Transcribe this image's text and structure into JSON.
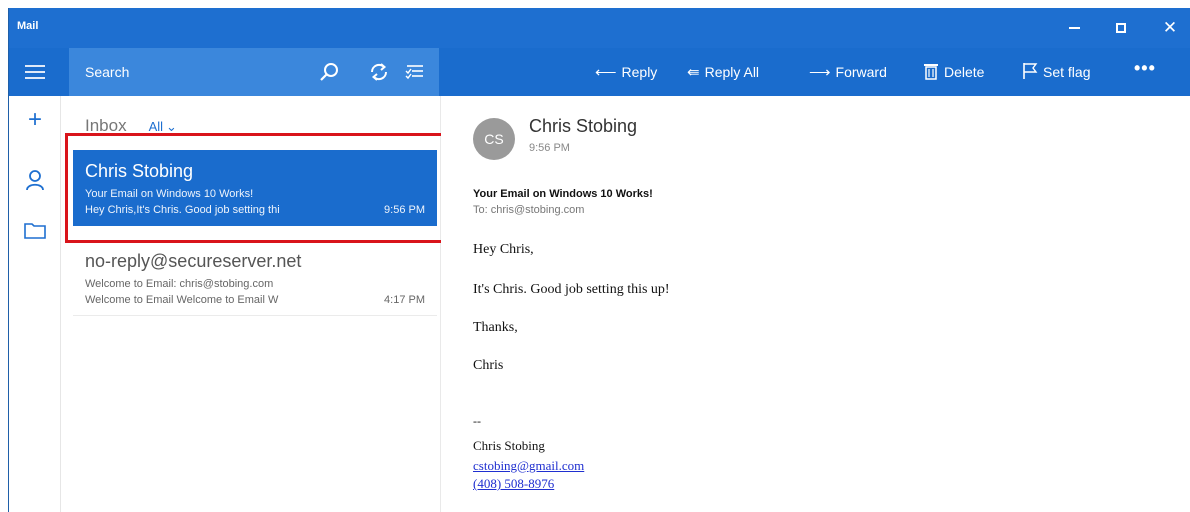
{
  "window": {
    "title": "Mail"
  },
  "search": {
    "placeholder": "Search"
  },
  "commands": {
    "reply": "Reply",
    "reply_all": "Reply All",
    "forward": "Forward",
    "delete": "Delete",
    "set_flag": "Set flag",
    "more": "•••"
  },
  "list": {
    "folder": "Inbox",
    "filter": "All",
    "messages": [
      {
        "sender": "Chris Stobing",
        "subject": "Your Email on Windows 10 Works!",
        "preview": "Hey Chris,It's Chris. Good job setting thi",
        "time": "9:56 PM",
        "selected": true
      },
      {
        "sender": "no-reply@secureserver.net",
        "subject": "Welcome to Email: chris@stobing.com",
        "preview": "Welcome to Email Welcome to Email W",
        "time": "4:17 PM",
        "selected": false
      }
    ]
  },
  "reading": {
    "avatar_initials": "CS",
    "from_name": "Chris Stobing",
    "time": "9:56 PM",
    "subject": "Your Email on Windows 10 Works!",
    "to": "To: chris@stobing.com",
    "greeting": "Hey Chris,",
    "body": "It's Chris. Good job setting this up!",
    "thanks": "Thanks,",
    "signoff": "Chris",
    "signature": {
      "dash": "--",
      "name": "Chris Stobing",
      "email": "cstobing@gmail.com",
      "phone": "(408) 508-8976"
    }
  },
  "colors": {
    "accent": "#1a6ccd",
    "highlight_border": "#d9141b"
  }
}
